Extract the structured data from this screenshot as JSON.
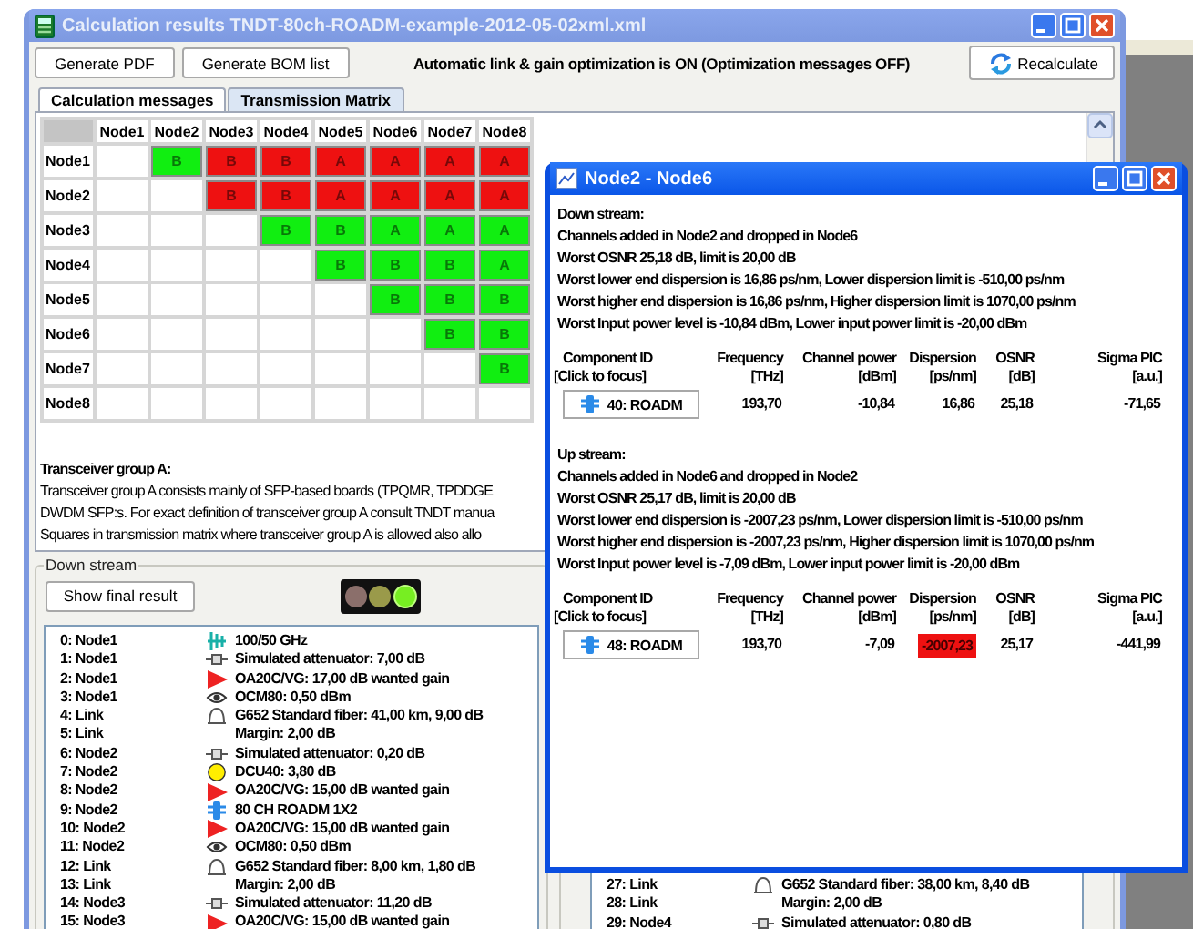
{
  "window": {
    "title": "Calculation results TNDT-80ch-ROADM-example-2012-05-02xml.xml"
  },
  "toolbar": {
    "buttons": [
      "Generate PDF",
      "Generate BOM list"
    ],
    "status": "Automatic link & gain optimization is ON (Optimization messages OFF)",
    "recalculate": "Recalculate"
  },
  "tabs": [
    {
      "label": "Calculation messages",
      "selected": false
    },
    {
      "label": "Transmission Matrix",
      "selected": true
    }
  ],
  "matrix": {
    "columns": [
      "Node1",
      "Node2",
      "Node3",
      "Node4",
      "Node5",
      "Node6",
      "Node7",
      "Node8"
    ],
    "rows": [
      {
        "label": "Node1",
        "cells": [
          {
            "kind": "empty"
          },
          {
            "kind": "group",
            "text": "B",
            "color": "#11ee11"
          },
          {
            "kind": "group",
            "text": "B",
            "color": "#ee1111"
          },
          {
            "kind": "group",
            "text": "B",
            "color": "#ee1111"
          },
          {
            "kind": "group",
            "text": "A",
            "color": "#ee1111"
          },
          {
            "kind": "group",
            "text": "A",
            "color": "#ee1111"
          },
          {
            "kind": "group",
            "text": "A",
            "color": "#ee1111"
          },
          {
            "kind": "group",
            "text": "A",
            "color": "#ee1111"
          }
        ]
      },
      {
        "label": "Node2",
        "cells": [
          {
            "kind": "empty"
          },
          {
            "kind": "empty"
          },
          {
            "kind": "group",
            "text": "B",
            "color": "#ee1111"
          },
          {
            "kind": "group",
            "text": "B",
            "color": "#ee1111"
          },
          {
            "kind": "group",
            "text": "A",
            "color": "#ee1111"
          },
          {
            "kind": "group",
            "text": "A",
            "color": "#ee1111"
          },
          {
            "kind": "group",
            "text": "A",
            "color": "#ee1111"
          },
          {
            "kind": "group",
            "text": "A",
            "color": "#ee1111"
          }
        ]
      },
      {
        "label": "Node3",
        "cells": [
          {
            "kind": "empty"
          },
          {
            "kind": "empty"
          },
          {
            "kind": "empty"
          },
          {
            "kind": "group",
            "text": "B",
            "color": "#11ee11"
          },
          {
            "kind": "group",
            "text": "B",
            "color": "#11ee11"
          },
          {
            "kind": "group",
            "text": "A",
            "color": "#11ee11"
          },
          {
            "kind": "group",
            "text": "A",
            "color": "#11ee11"
          },
          {
            "kind": "group",
            "text": "A",
            "color": "#11ee11"
          }
        ]
      },
      {
        "label": "Node4",
        "cells": [
          {
            "kind": "empty"
          },
          {
            "kind": "empty"
          },
          {
            "kind": "empty"
          },
          {
            "kind": "empty"
          },
          {
            "kind": "group",
            "text": "B",
            "color": "#11ee11"
          },
          {
            "kind": "group",
            "text": "B",
            "color": "#11ee11"
          },
          {
            "kind": "group",
            "text": "B",
            "color": "#11ee11"
          },
          {
            "kind": "group",
            "text": "A",
            "color": "#11ee11"
          }
        ]
      },
      {
        "label": "Node5",
        "cells": [
          {
            "kind": "empty"
          },
          {
            "kind": "empty"
          },
          {
            "kind": "empty"
          },
          {
            "kind": "empty"
          },
          {
            "kind": "empty"
          },
          {
            "kind": "group",
            "text": "B",
            "color": "#11ee11"
          },
          {
            "kind": "group",
            "text": "B",
            "color": "#11ee11"
          },
          {
            "kind": "group",
            "text": "B",
            "color": "#11ee11"
          }
        ]
      },
      {
        "label": "Node6",
        "cells": [
          {
            "kind": "empty"
          },
          {
            "kind": "empty"
          },
          {
            "kind": "empty"
          },
          {
            "kind": "empty"
          },
          {
            "kind": "empty"
          },
          {
            "kind": "empty"
          },
          {
            "kind": "group",
            "text": "B",
            "color": "#11ee11"
          },
          {
            "kind": "group",
            "text": "B",
            "color": "#11ee11"
          }
        ]
      },
      {
        "label": "Node7",
        "cells": [
          {
            "kind": "empty"
          },
          {
            "kind": "empty"
          },
          {
            "kind": "empty"
          },
          {
            "kind": "empty"
          },
          {
            "kind": "empty"
          },
          {
            "kind": "empty"
          },
          {
            "kind": "empty"
          },
          {
            "kind": "group",
            "text": "B",
            "color": "#11ee11"
          }
        ]
      },
      {
        "label": "Node8",
        "cells": [
          {
            "kind": "empty"
          },
          {
            "kind": "empty"
          },
          {
            "kind": "empty"
          },
          {
            "kind": "empty"
          },
          {
            "kind": "empty"
          },
          {
            "kind": "empty"
          },
          {
            "kind": "empty"
          },
          {
            "kind": "empty"
          }
        ]
      }
    ]
  },
  "description": {
    "heading": "Transceiver group A:",
    "lines": [
      "Transceiver group A consists mainly of SFP-based boards (TPQMR, TPDDGE",
      "DWDM SFP:s. For exact definition of transceiver group A consult TNDT manua",
      "Squares in transmission matrix where transceiver group A is allowed also allo"
    ]
  },
  "downstream": {
    "title": "Down stream",
    "button": "Show final result",
    "lights": [
      {
        "color": "#8b6f6b",
        "on": false
      },
      {
        "color": "#9a9a4a",
        "on": false
      },
      {
        "color": "#77ee22",
        "on": true
      }
    ],
    "items": [
      {
        "index": "0: Node1",
        "kind": "filter",
        "text": "100/50 GHz"
      },
      {
        "index": "1: Node1",
        "kind": "attenuator",
        "text": "Simulated attenuator: 7,00 dB"
      },
      {
        "index": "2: Node1",
        "kind": "amplifier",
        "text": "OA20C/VG: 17,00 dB wanted gain"
      },
      {
        "index": "3: Node1",
        "kind": "ocm",
        "text": "OCM80: 0,50  dBm"
      },
      {
        "index": "4: Link",
        "kind": "fiber",
        "text": "G652 Standard  fiber: 41,00 km, 9,00 dB"
      },
      {
        "index": "5: Link",
        "kind": "margin",
        "text": "Margin: 2,00 dB"
      },
      {
        "index": "6: Node2",
        "kind": "attenuator",
        "text": "Simulated attenuator: 0,20 dB"
      },
      {
        "index": "7: Node2",
        "kind": "dcu",
        "text": "DCU40: 3,80 dB"
      },
      {
        "index": "8: Node2",
        "kind": "amplifier",
        "text": "OA20C/VG: 15,00 dB wanted gain"
      },
      {
        "index": "9: Node2",
        "kind": "roadm",
        "text": "80 CH ROADM 1X2"
      },
      {
        "index": "10: Node2",
        "kind": "amplifier",
        "text": "OA20C/VG: 15,00 dB wanted gain"
      },
      {
        "index": "11: Node2",
        "kind": "ocm",
        "text": "OCM80: 0,50  dBm"
      },
      {
        "index": "12: Link",
        "kind": "fiber",
        "text": "G652 Standard  fiber: 8,00 km, 1,80 dB"
      },
      {
        "index": "13: Link",
        "kind": "margin",
        "text": "Margin: 2,00 dB"
      },
      {
        "index": "14: Node3",
        "kind": "attenuator",
        "text": "Simulated attenuator: 11,20 dB"
      },
      {
        "index": "15: Node3",
        "kind": "amplifier",
        "text": "OA20C/VG: 15,00 dB wanted gain"
      }
    ]
  },
  "upstream": {
    "items": [
      {
        "index": "27: Link",
        "kind": "fiber",
        "text": "G652 Standard  fiber: 38,00 km, 8,40 dB"
      },
      {
        "index": "28: Link",
        "kind": "margin",
        "text": "Margin: 2,00 dB"
      },
      {
        "index": "29: Node4",
        "kind": "attenuator",
        "text": "Simulated attenuator: 0,80 dB"
      }
    ]
  },
  "popup": {
    "title": "Node2 - Node6",
    "sections": [
      {
        "heading": "Down stream:",
        "lines": [
          "Channels added in Node2 and dropped in Node6",
          "Worst OSNR 25,18 dB, limit is 20,00 dB",
          "Worst lower end dispersion is 16,86 ps/nm, Lower dispersion limit is -510,00 ps/nm",
          "Worst higher end dispersion is 16,86 ps/nm, Higher dispersion limit is 1070,00 ps/nm",
          "Worst Input power level is -10,84 dBm, Lower input power limit is -20,00 dBm"
        ],
        "columns": [
          {
            "name": "Component ID",
            "unit": "[Click to focus]"
          },
          {
            "name": "Frequency",
            "unit": "[THz]"
          },
          {
            "name": "Channel power",
            "unit": "[dBm]"
          },
          {
            "name": "Dispersion",
            "unit": "[ps/nm]"
          },
          {
            "name": "OSNR",
            "unit": "[dB]"
          },
          {
            "name": "Sigma PIC",
            "unit": "[a.u.]"
          }
        ],
        "rows": [
          {
            "component": "40: ROADM",
            "values": [
              {
                "text": "193,70",
                "alarm": false
              },
              {
                "text": "-10,84",
                "alarm": false
              },
              {
                "text": "16,86",
                "alarm": false
              },
              {
                "text": "25,18",
                "alarm": false
              },
              {
                "text": "-71,65",
                "alarm": false
              }
            ]
          }
        ]
      },
      {
        "heading": "Up stream:",
        "lines": [
          "Channels added in Node6 and dropped in Node2",
          "Worst OSNR 25,17 dB, limit is 20,00 dB",
          "Worst lower end dispersion is -2007,23 ps/nm, Lower dispersion limit is -510,00 ps/nm",
          "Worst higher end dispersion is -2007,23 ps/nm, Higher dispersion limit is 1070,00 ps/nm",
          "Worst Input power level is -7,09 dBm, Lower input power limit is -20,00 dBm"
        ],
        "columns": [
          {
            "name": "Component ID",
            "unit": "[Click to focus]"
          },
          {
            "name": "Frequency",
            "unit": "[THz]"
          },
          {
            "name": "Channel power",
            "unit": "[dBm]"
          },
          {
            "name": "Dispersion",
            "unit": "[ps/nm]"
          },
          {
            "name": "OSNR",
            "unit": "[dB]"
          },
          {
            "name": "Sigma PIC",
            "unit": "[a.u.]"
          }
        ],
        "rows": [
          {
            "component": "48: ROADM",
            "values": [
              {
                "text": "193,70",
                "alarm": false
              },
              {
                "text": "-7,09",
                "alarm": false
              },
              {
                "text": "-2007,23",
                "alarm": true
              },
              {
                "text": "25,17",
                "alarm": false
              },
              {
                "text": "-441,99",
                "alarm": false
              }
            ]
          }
        ]
      }
    ]
  }
}
